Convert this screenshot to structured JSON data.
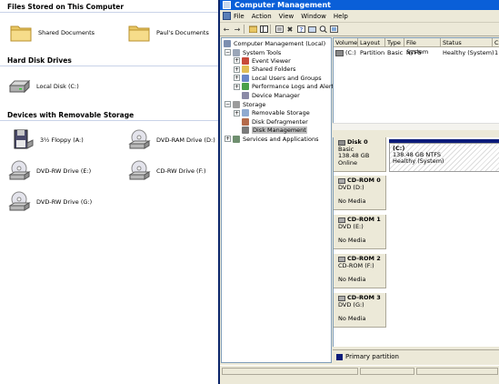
{
  "my_computer": {
    "sections": [
      {
        "title": "Files Stored on This Computer",
        "items": [
          {
            "label": "Shared Documents",
            "icon": "folder-icon"
          },
          {
            "label": "Paul's Documents",
            "icon": "folder-icon"
          }
        ]
      },
      {
        "title": "Hard Disk Drives",
        "items": [
          {
            "label": "Local Disk (C:)",
            "icon": "hard-disk-icon"
          }
        ]
      },
      {
        "title": "Devices with Removable Storage",
        "items": [
          {
            "label": "3½ Floppy (A:)",
            "icon": "floppy-icon"
          },
          {
            "label": "DVD-RAM Drive (D:)",
            "icon": "dvd-drive-icon"
          },
          {
            "label": "DVD-RW Drive (E:)",
            "icon": "dvd-drive-icon"
          },
          {
            "label": "CD-RW Drive (F:)",
            "icon": "cd-drive-icon"
          },
          {
            "label": "DVD-RW Drive (G:)",
            "icon": "dvd-drive-icon"
          }
        ]
      }
    ]
  },
  "cm_window": {
    "title": "Computer Management",
    "menu": [
      "File",
      "Action",
      "View",
      "Window",
      "Help"
    ],
    "toolbar_icons": [
      "back-icon",
      "forward-icon",
      "up-icon",
      "show-hide-tree-icon",
      "properties-icon",
      "delete-icon",
      "help-icon",
      "wizard-icon",
      "search-icon",
      "refresh-icon"
    ],
    "tree": {
      "root": "Computer Management (Local)",
      "system_tools": "System Tools",
      "event_viewer": "Event Viewer",
      "shared_folders": "Shared Folders",
      "local_users": "Local Users and Groups",
      "perf_logs": "Performance Logs and Alerts",
      "device_manager": "Device Manager",
      "storage": "Storage",
      "removable_storage": "Removable Storage",
      "disk_defrag": "Disk Defragmenter",
      "disk_mgmt": "Disk Management",
      "services": "Services and Applications"
    },
    "volume_list": {
      "columns": [
        "Volume",
        "Layout",
        "Type",
        "File System",
        "Status",
        "C"
      ],
      "rows": [
        {
          "volume": "(C:)",
          "layout": "Partition",
          "type": "Basic",
          "fs": "NTFS",
          "status": "Healthy (System)",
          "cap": "1"
        }
      ]
    },
    "disks": [
      {
        "name": "Disk 0",
        "line2": "Basic",
        "line3": "138.48 GB",
        "line4": "Online",
        "icon": "hard-disk-icon"
      },
      {
        "name": "CD-ROM 0",
        "line2": "DVD (D:)",
        "line3": "",
        "line4": "No Media",
        "icon": "cd-rom-icon"
      },
      {
        "name": "CD-ROM 1",
        "line2": "DVD (E:)",
        "line3": "",
        "line4": "No Media",
        "icon": "cd-rom-icon"
      },
      {
        "name": "CD-ROM 2",
        "line2": "CD-ROM (F:)",
        "line3": "",
        "line4": "No Media",
        "icon": "cd-rom-icon"
      },
      {
        "name": "CD-ROM 3",
        "line2": "DVD (G:)",
        "line3": "",
        "line4": "No Media",
        "icon": "cd-rom-icon"
      }
    ],
    "partition": {
      "name": "(C:)",
      "size": "138.48 GB NTFS",
      "status": "Healthy (System)"
    },
    "legend": "Primary partition",
    "colors": {
      "title_bar": "#0a5fd8",
      "partition_bar": "#0c1c7a",
      "face": "#ece9d8"
    }
  }
}
